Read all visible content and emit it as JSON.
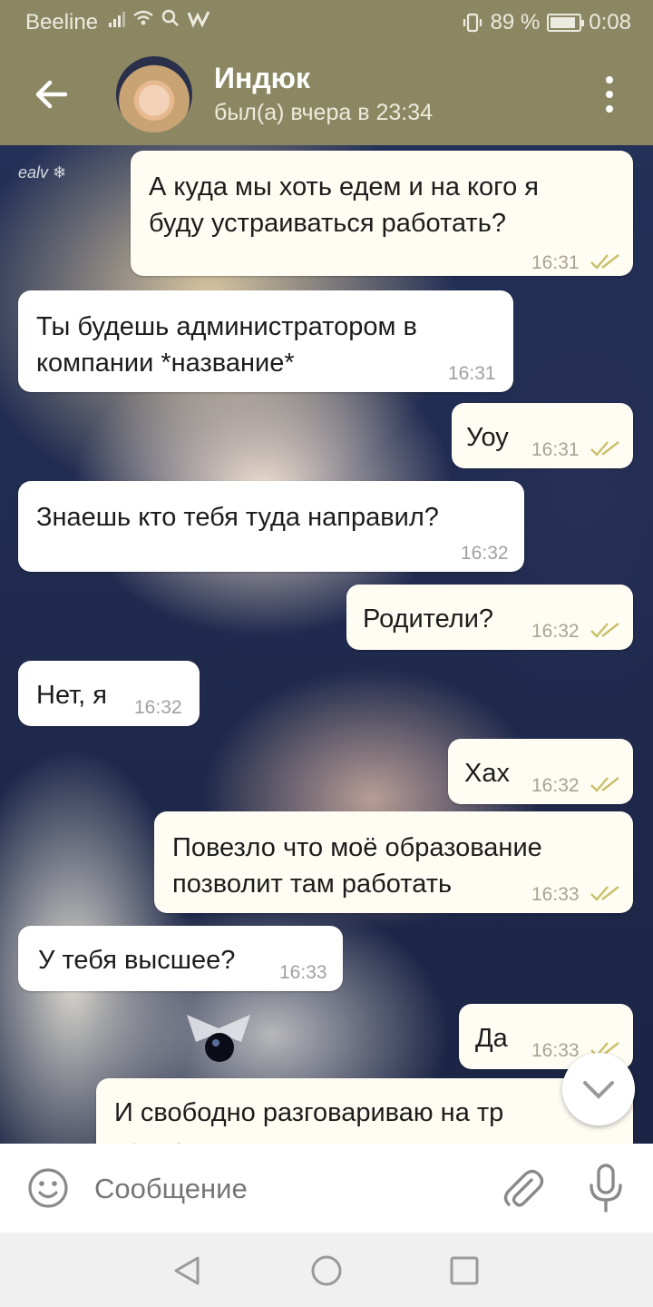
{
  "status_bar": {
    "carrier": "Beeline",
    "battery": "89 %",
    "time": "0:08",
    "battery_level": 0.89
  },
  "header": {
    "contact_name": "Индюк",
    "last_seen": "был(а) вчера в 23:34"
  },
  "chat": {
    "watermark": "ealv ❄",
    "messages": [
      {
        "direction": "out",
        "text": "А куда мы хоть едем и на кого я\nбуду устраиваться работать?",
        "time": "16:31",
        "read": true
      },
      {
        "direction": "in",
        "text": "Ты будешь администратором в\nкомпании *название*",
        "time": "16:31"
      },
      {
        "direction": "out",
        "text": "Уоу",
        "time": "16:31",
        "read": true
      },
      {
        "direction": "in",
        "text": "Знаешь кто тебя туда направил?",
        "time": "16:32"
      },
      {
        "direction": "out",
        "text": "Родители?",
        "time": "16:32",
        "read": true
      },
      {
        "direction": "in",
        "text": "Нет, я",
        "time": "16:32"
      },
      {
        "direction": "out",
        "text": "Хах",
        "time": "16:32",
        "read": true
      },
      {
        "direction": "out",
        "text": "Повезло что моё образование\nпозволит там работать",
        "time": "16:33",
        "read": true
      },
      {
        "direction": "in",
        "text": "У тебя высшее?",
        "time": "16:33"
      },
      {
        "direction": "out",
        "text": "Да",
        "time": "16:33",
        "read": true
      },
      {
        "direction": "out",
        "text": "И свободно разговариваю на тр\nязыках",
        "time": "",
        "read": false
      }
    ]
  },
  "input": {
    "placeholder": "Сообщение"
  },
  "icons": {
    "back": "arrow-left-icon",
    "menu": "more-vertical-icon",
    "scroll": "chevron-down-icon",
    "emoji": "emoji-icon",
    "attach": "paperclip-icon",
    "mic": "microphone-icon",
    "nav_back": "triangle-back-icon",
    "nav_home": "circle-home-icon",
    "nav_recents": "square-recents-icon"
  },
  "colors": {
    "header": "#8c8763",
    "bubble_out": "#fffdf3",
    "bubble_in": "#ffffff",
    "read_checks": "#c9c06a"
  }
}
